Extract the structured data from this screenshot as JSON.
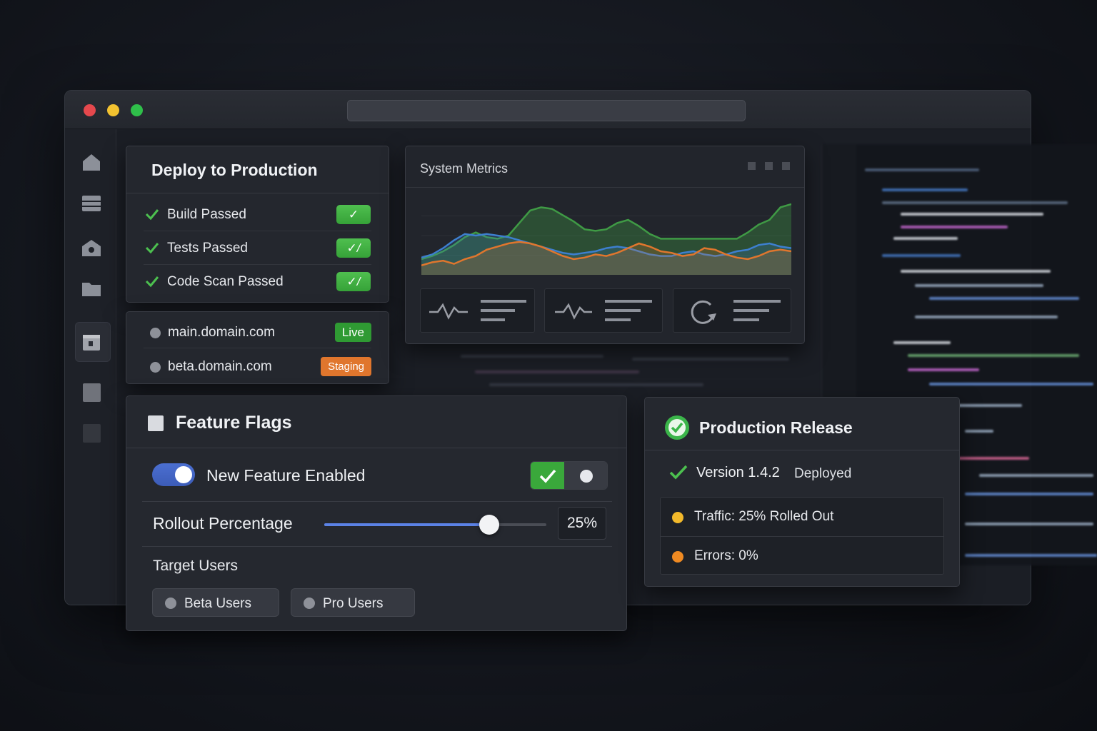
{
  "deploy": {
    "title": "Deploy to Production",
    "checks": [
      {
        "label": "Build Passed",
        "badge": "✓"
      },
      {
        "label": "Tests Passed",
        "badge": "✓/"
      },
      {
        "label": "Code Scan Passed",
        "badge": "✓/"
      }
    ],
    "domains": [
      {
        "label": "main.domain.com",
        "badge": "Live"
      },
      {
        "label": "beta.domain.com",
        "badge": "Staging"
      }
    ]
  },
  "metrics": {
    "title": "System Metrics",
    "stat_icons": [
      "pulse-icon",
      "pulse-icon",
      "refresh-icon"
    ]
  },
  "chart_data": {
    "type": "area",
    "x": [
      0,
      1,
      2,
      3,
      4,
      5,
      6,
      7,
      8,
      9,
      10,
      11,
      12,
      13,
      14,
      15,
      16,
      17,
      18,
      19,
      20,
      21,
      22,
      23,
      24,
      25,
      26,
      27,
      28,
      29,
      30,
      31,
      32,
      33,
      34
    ],
    "series": [
      {
        "color": "#3f9a45",
        "values": [
          20,
          24,
          30,
          38,
          48,
          54,
          48,
          46,
          50,
          66,
          82,
          86,
          84,
          76,
          68,
          58,
          56,
          58,
          66,
          70,
          62,
          52,
          46,
          46,
          46,
          46,
          46,
          46,
          46,
          46,
          54,
          64,
          70,
          86,
          90
        ]
      },
      {
        "color": "#3d7fcf",
        "values": [
          22,
          26,
          34,
          44,
          52,
          50,
          52,
          50,
          48,
          44,
          40,
          36,
          32,
          28,
          26,
          28,
          30,
          34,
          36,
          34,
          30,
          26,
          24,
          24,
          28,
          30,
          26,
          24,
          26,
          30,
          32,
          38,
          40,
          36,
          34
        ]
      },
      {
        "color": "#e0762d",
        "values": [
          12,
          16,
          18,
          14,
          20,
          24,
          32,
          36,
          40,
          42,
          40,
          36,
          30,
          24,
          20,
          22,
          26,
          24,
          28,
          34,
          40,
          36,
          30,
          28,
          24,
          26,
          34,
          32,
          26,
          22,
          20,
          24,
          30,
          32,
          30
        ]
      }
    ]
  },
  "flags": {
    "title": "Feature Flags",
    "feature_label": "New Feature Enabled",
    "feature_enabled": true,
    "rollout_label": "Rollout Percentage",
    "rollout_value": 25,
    "rollout_display": "25%",
    "target_label": "Target Users",
    "targets": [
      "Beta Users",
      "Pro Users"
    ]
  },
  "release": {
    "title": "Production Release",
    "version": "Version 1.4.2",
    "status": "Deployed",
    "traffic": "Traffic: 25% Rolled Out",
    "errors": "Errors: 0%",
    "colors": {
      "traffic": "#f2b92b",
      "errors": "#ef8a22",
      "ok": "#3bb54a"
    }
  }
}
